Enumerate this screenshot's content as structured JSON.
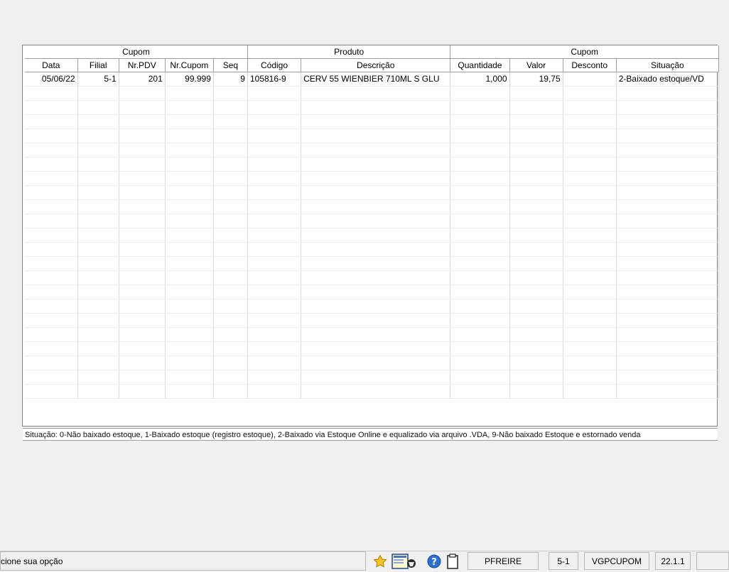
{
  "grid": {
    "group_headers": [
      {
        "label": "Cupom"
      },
      {
        "label": "Produto"
      },
      {
        "label": "Cupom"
      }
    ],
    "columns": [
      "Data",
      "Filial",
      "Nr.PDV",
      "Nr.Cupom",
      "Seq",
      "Código",
      "Descrição",
      "Quantidade",
      "Valor",
      "Desconto",
      "Situação"
    ],
    "rows": [
      {
        "data": "05/06/22",
        "filial": "5-1",
        "nr_pdv": "201",
        "nr_cupom": "99.999",
        "seq": "9",
        "codigo": "105816-9",
        "descricao": "CERV 55 WIENBIER 710ML S GLU",
        "quantidade": "1,000",
        "valor": "19,75",
        "desconto": "",
        "situacao": "2-Baixado estoque/VD"
      }
    ],
    "highlight_color": "#e02020"
  },
  "legend": "Situação: 0-Não baixado estoque, 1-Baixado estoque (registro estoque), 2-Baixado via Estoque Online e equalizado via arquivo .VDA, 9-Não baixado Estoque e estornado venda",
  "statusbar": {
    "message": "cione sua opção",
    "icons": [
      "star-icon",
      "report-icon",
      "help-icon",
      "clipboard-icon"
    ],
    "user": "PFREIRE",
    "filial": "5-1",
    "program": "VGPCUPOM",
    "version": "22.1.1"
  }
}
